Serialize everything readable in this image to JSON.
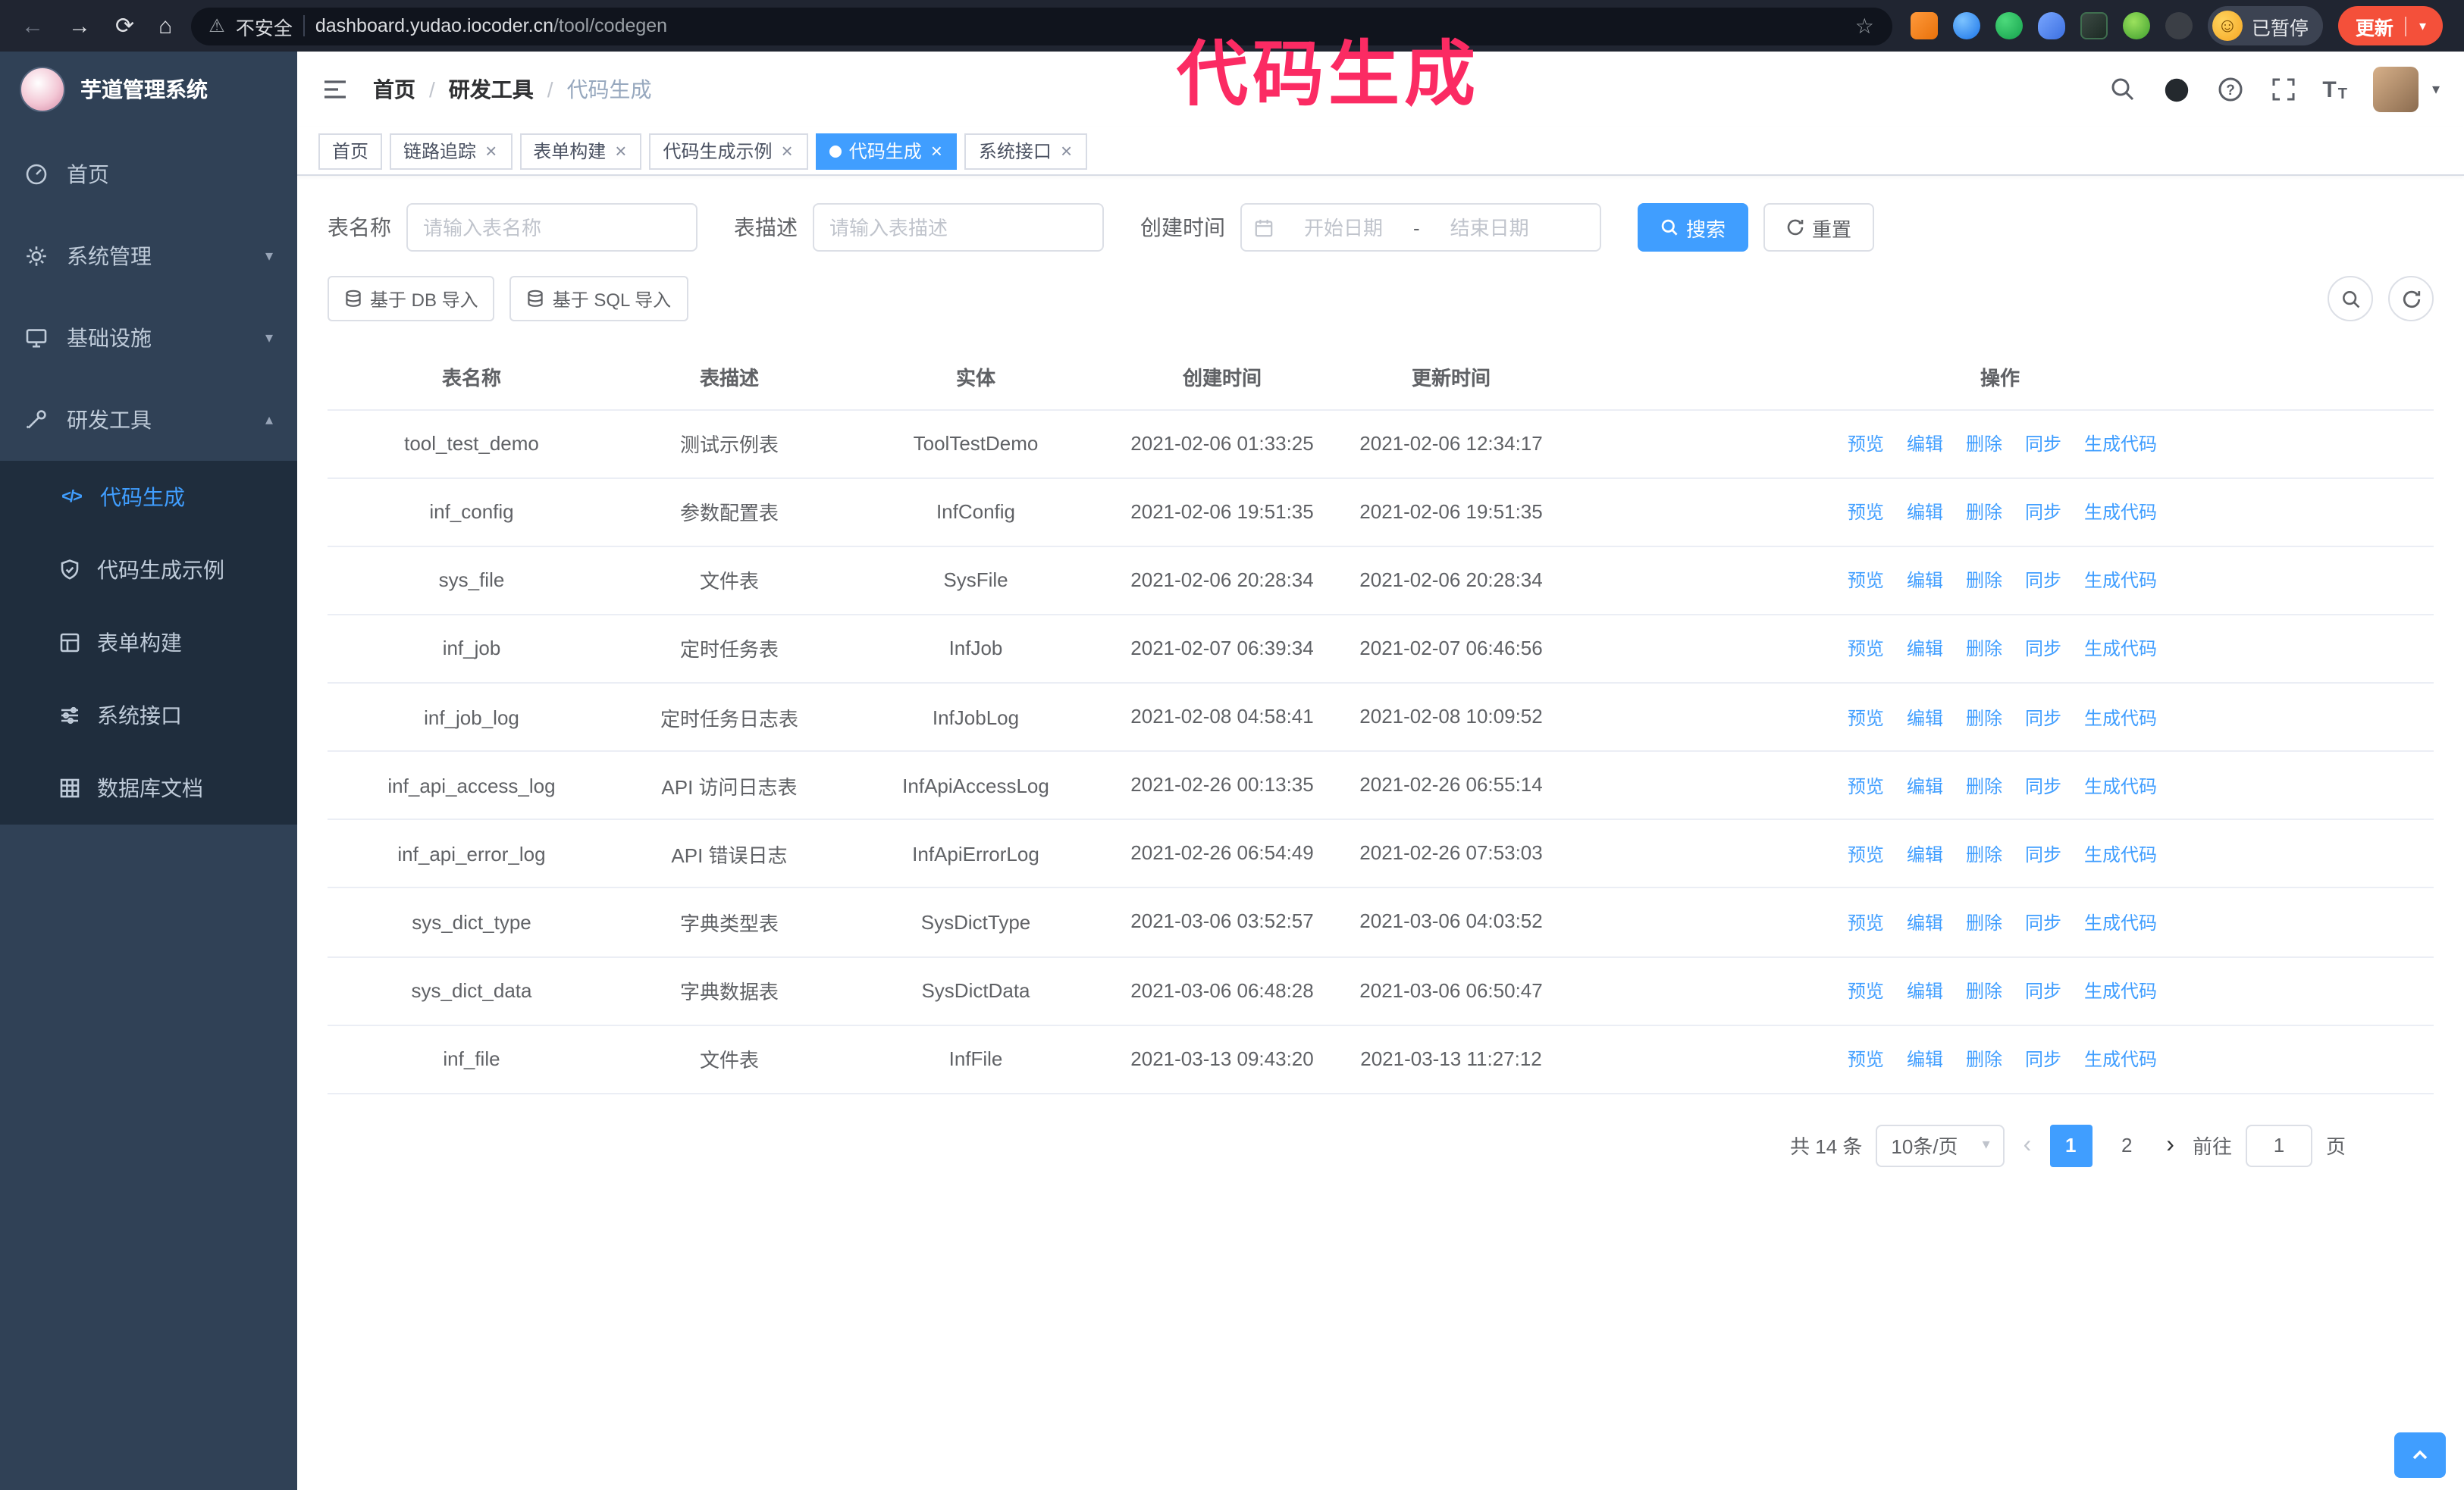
{
  "colors": {
    "primary": "#409eff",
    "sidebar_bg": "#304156",
    "submenu_bg": "#1f2d3d",
    "chrome_bg": "#202531",
    "addressbar_bg": "#10141d",
    "update_button": "#f4503a",
    "annotation": "#fb2b63"
  },
  "annotation": {
    "text": "代码生成"
  },
  "browser": {
    "not_secure": "不安全",
    "url_domain": "dashboard.yudao.iocoder.cn",
    "url_path": "/tool/codegen",
    "paused_badge": "已暂停",
    "update_button": "更新"
  },
  "icons": {
    "back": "←",
    "forward": "→",
    "reload": "⟳",
    "home": "⌂",
    "warning": "⚠",
    "star": "☆",
    "close": "×",
    "caret_down": "▾",
    "caret_up": "▴",
    "smiley": "☺",
    "code": "</>",
    "prev": "‹",
    "next": "›",
    "slash": "/",
    "letter_t": "T",
    "question": "?"
  },
  "sidebar": {
    "logo_title": "芋道管理系统",
    "items": [
      {
        "label": "首页"
      },
      {
        "label": "系统管理"
      },
      {
        "label": "基础设施"
      },
      {
        "label": "研发工具",
        "expanded": true
      }
    ],
    "subitems": [
      {
        "label": "代码生成",
        "active": true
      },
      {
        "label": "代码生成示例"
      },
      {
        "label": "表单构建"
      },
      {
        "label": "系统接口"
      },
      {
        "label": "数据库文档"
      }
    ]
  },
  "header": {
    "breadcrumb": [
      "首页",
      "研发工具",
      "代码生成"
    ]
  },
  "tabs": [
    {
      "label": "首页",
      "closable": false,
      "active": false
    },
    {
      "label": "链路追踪",
      "closable": true,
      "active": false
    },
    {
      "label": "表单构建",
      "closable": true,
      "active": false
    },
    {
      "label": "代码生成示例",
      "closable": true,
      "active": false
    },
    {
      "label": "代码生成",
      "closable": true,
      "active": true
    },
    {
      "label": "系统接口",
      "closable": true,
      "active": false
    }
  ],
  "filters": {
    "table_name_label": "表名称",
    "table_name_placeholder": "请输入表名称",
    "table_desc_label": "表描述",
    "table_desc_placeholder": "请输入表描述",
    "create_time_label": "创建时间",
    "date_start_placeholder": "开始日期",
    "date_separator": "-",
    "date_end_placeholder": "结束日期",
    "search_label": "搜索",
    "reset_label": "重置"
  },
  "toolbar": {
    "import_db": "基于 DB 导入",
    "import_sql": "基于 SQL 导入"
  },
  "table": {
    "columns": [
      "表名称",
      "表描述",
      "实体",
      "创建时间",
      "更新时间",
      "操作"
    ],
    "ops": [
      "预览",
      "编辑",
      "删除",
      "同步",
      "生成代码"
    ],
    "rows": [
      [
        "tool_test_demo",
        "测试示例表",
        "ToolTestDemo",
        "2021-02-06 01:33:25",
        "2021-02-06 12:34:17"
      ],
      [
        "inf_config",
        "参数配置表",
        "InfConfig",
        "2021-02-06 19:51:35",
        "2021-02-06 19:51:35"
      ],
      [
        "sys_file",
        "文件表",
        "SysFile",
        "2021-02-06 20:28:34",
        "2021-02-06 20:28:34"
      ],
      [
        "inf_job",
        "定时任务表",
        "InfJob",
        "2021-02-07 06:39:34",
        "2021-02-07 06:46:56"
      ],
      [
        "inf_job_log",
        "定时任务日志表",
        "InfJobLog",
        "2021-02-08 04:58:41",
        "2021-02-08 10:09:52"
      ],
      [
        "inf_api_access_log",
        "API 访问日志表",
        "InfApiAccessLog",
        "2021-02-26 00:13:35",
        "2021-02-26 06:55:14"
      ],
      [
        "inf_api_error_log",
        "API 错误日志",
        "InfApiErrorLog",
        "2021-02-26 06:54:49",
        "2021-02-26 07:53:03"
      ],
      [
        "sys_dict_type",
        "字典类型表",
        "SysDictType",
        "2021-03-06 03:52:57",
        "2021-03-06 04:03:52"
      ],
      [
        "sys_dict_data",
        "字典数据表",
        "SysDictData",
        "2021-03-06 06:48:28",
        "2021-03-06 06:50:47"
      ],
      [
        "inf_file",
        "文件表",
        "InfFile",
        "2021-03-13 09:43:20",
        "2021-03-13 11:27:12"
      ]
    ]
  },
  "pagination": {
    "total_text": "共 14 条",
    "page_size": "10条/页",
    "pages": [
      "1",
      "2"
    ],
    "active_page": "1",
    "goto_label": "前往",
    "goto_value": "1",
    "goto_suffix": "页"
  }
}
